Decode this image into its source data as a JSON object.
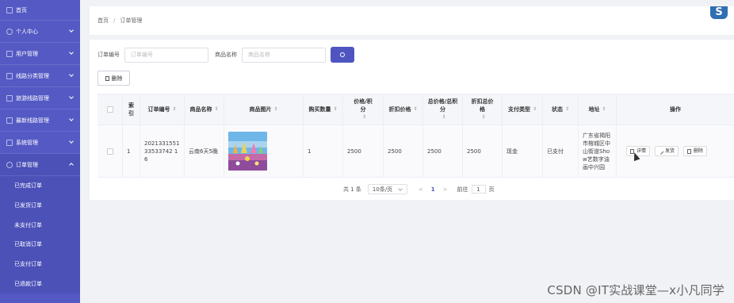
{
  "sidebar": {
    "items": [
      {
        "label": "首页",
        "icon": "home-icon"
      },
      {
        "label": "个人中心",
        "icon": "user-icon"
      },
      {
        "label": "用户管理",
        "icon": "users-icon"
      },
      {
        "label": "线路分类管理",
        "icon": "filter-icon"
      },
      {
        "label": "旅游线路管理",
        "icon": "route-icon"
      },
      {
        "label": "最新线路管理",
        "icon": "mail-icon"
      },
      {
        "label": "系统管理",
        "icon": "system-icon"
      },
      {
        "label": "订单管理",
        "icon": "order-icon"
      }
    ],
    "subitems": [
      "已完成订单",
      "已发货订单",
      "未支付订单",
      "已取消订单",
      "已支付订单",
      "已退款订单"
    ]
  },
  "breadcrumb": {
    "home": "首页",
    "sep": "/",
    "current": "订单管理"
  },
  "logo": {
    "letter": "S"
  },
  "search": {
    "order_label": "订单编号",
    "order_placeholder": "订单编号",
    "product_label": "商品名称",
    "product_placeholder": "商品名称"
  },
  "toolbar": {
    "delete_label": "删除"
  },
  "table": {
    "headers": {
      "index": "索引",
      "order_no": "订单编号",
      "product_name": "商品名称",
      "product_image": "商品图片",
      "quantity": "购买数量",
      "price_points_1": "价格/积",
      "price_points_2": "分",
      "discount_price": "折扣价格",
      "total_price_1": "总价格/总积",
      "total_price_2": "分",
      "discount_total_1": "折扣总价",
      "discount_total_2": "格",
      "payment_type": "支付类型",
      "status": "状态",
      "address": "地址",
      "actions": "操作"
    },
    "sort_glyph": "⇕",
    "rows": [
      {
        "index": "1",
        "order_no": "202133155133533742 16",
        "product_name": "云南6天5晚",
        "quantity": "1",
        "price": "2500",
        "discount_price": "2500",
        "total_price": "2500",
        "discount_total": "2500",
        "payment_type": "现金",
        "status": "已支付",
        "address": "广东省揭阳市榕城区中山街道Show艺数字油画中兴园",
        "detail_label": "详情",
        "ship_label": "发货",
        "delete_label": "删除"
      }
    ]
  },
  "pagination": {
    "total": "共 1 条",
    "page_size": "10条/页",
    "prev": "<",
    "current_page": "1",
    "next": ">",
    "goto_label": "前往",
    "goto_value": "1",
    "page_suffix": "页"
  },
  "watermark": "CSDN @IT实战课堂—x小凡同学"
}
